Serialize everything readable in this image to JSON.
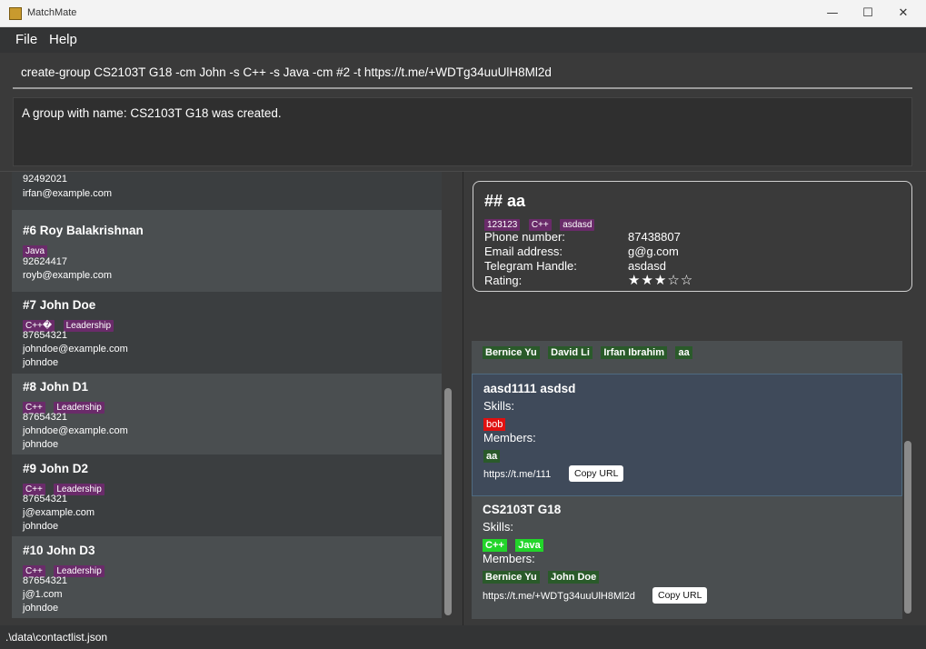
{
  "window": {
    "title": "MatchMate",
    "minimize": "—",
    "maximize": "☐",
    "close": "✕"
  },
  "menu": {
    "file": "File",
    "help": "Help"
  },
  "command": {
    "text": "create-group CS2103T G18 -cm John -s C++ -s Java -cm #2 -t https://t.me/+WDTg34uuUlH8Ml2d"
  },
  "result": {
    "text": "A group with name: CS2103T G18 was created."
  },
  "contacts": {
    "partial": {
      "phone": "92492021",
      "email": "irfan@example.com"
    },
    "items": [
      {
        "name": "#6  Roy Balakrishnan",
        "tags": [
          "Java"
        ],
        "phone": "92624417",
        "email": "royb@example.com",
        "telegram": ""
      },
      {
        "name": "#7  John Doe",
        "tags": [
          "C++�",
          "Leadership"
        ],
        "phone": "87654321",
        "email": "johndoe@example.com",
        "telegram": "johndoe"
      },
      {
        "name": "#8  John D1",
        "tags": [
          "C++",
          "Leadership"
        ],
        "phone": "87654321",
        "email": "johndoe@example.com",
        "telegram": "johndoe"
      },
      {
        "name": "#9  John D2",
        "tags": [
          "C++",
          "Leadership"
        ],
        "phone": "87654321",
        "email": "j@example.com",
        "telegram": "johndoe"
      },
      {
        "name": "#10  John D3",
        "tags": [
          "C++",
          "Leadership"
        ],
        "phone": "87654321",
        "email": "j@1.com",
        "telegram": "johndoe"
      }
    ]
  },
  "detail": {
    "heading": "## aa",
    "tags": [
      "123123",
      "C++",
      "asdasd"
    ],
    "phone_label": "Phone number:",
    "phone": "87438807",
    "email_label": "Email address:",
    "email": "g@g.com",
    "telegram_label": "Telegram Handle:",
    "telegram": "asdasd",
    "rating_label": "Rating:",
    "rating": "★★★☆☆",
    "rating_value": 3,
    "rating_max": 5
  },
  "groups": {
    "partial_members": [
      "Bernice Yu",
      "David Li",
      "Irfan Ibrahim",
      "aa"
    ],
    "items": [
      {
        "name": "aasd1111 asdsd",
        "skills_label": "Skills:",
        "skills": [
          "bob"
        ],
        "members_label": "Members:",
        "members": [
          "aa"
        ],
        "url": "https://t.me/111",
        "copy": "Copy URL"
      },
      {
        "name": "CS2103T G18",
        "skills_label": "Skills:",
        "skills": [
          "C++",
          "Java"
        ],
        "members_label": "Members:",
        "members": [
          "Bernice Yu",
          "John Doe"
        ],
        "url": "https://t.me/+WDTg34uuUlH8Ml2d",
        "copy": "Copy URL"
      }
    ]
  },
  "status": {
    "path": ".\\data\\contactlist.json"
  },
  "colors": {
    "contact_tag": "#6a2b6a",
    "member_tag": "#2a5a2a",
    "skill_green": "#22d52a",
    "skill_red": "#e01010",
    "selected_group": "#3f4a5a"
  }
}
